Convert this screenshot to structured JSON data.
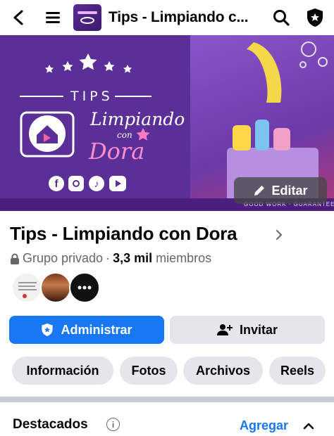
{
  "topbar": {
    "title": "Tips - Limpiando c...",
    "icons": [
      "back-arrow-icon",
      "menu-icon",
      "search-icon",
      "shield-star-icon"
    ]
  },
  "cover": {
    "brand_word": "TIPS",
    "script_title_1": "Limpiando",
    "script_title_2": "con",
    "script_title_3": "Dora",
    "watermark": "GOOD WORK · GUARANTEED",
    "social_icons": [
      "facebook-icon",
      "instagram-icon",
      "tiktok-icon",
      "youtube-icon"
    ],
    "edit_label": "Editar"
  },
  "group": {
    "name": "Tips - Limpiando con Dora",
    "privacy": "Grupo privado",
    "separator": "·",
    "members_count": "3,3 mil",
    "members_word": "miembros"
  },
  "actions": {
    "admin_label": "Administrar",
    "invite_label": "Invitar"
  },
  "tabs": [
    "Información",
    "Fotos",
    "Archivos",
    "Reels"
  ],
  "featured": {
    "title": "Destacados",
    "info_symbol": "i",
    "add_label": "Agregar"
  },
  "colors": {
    "accent": "#1877f2",
    "cover_purple": "#5a2f97",
    "pill_bg": "#e4e6eb"
  }
}
